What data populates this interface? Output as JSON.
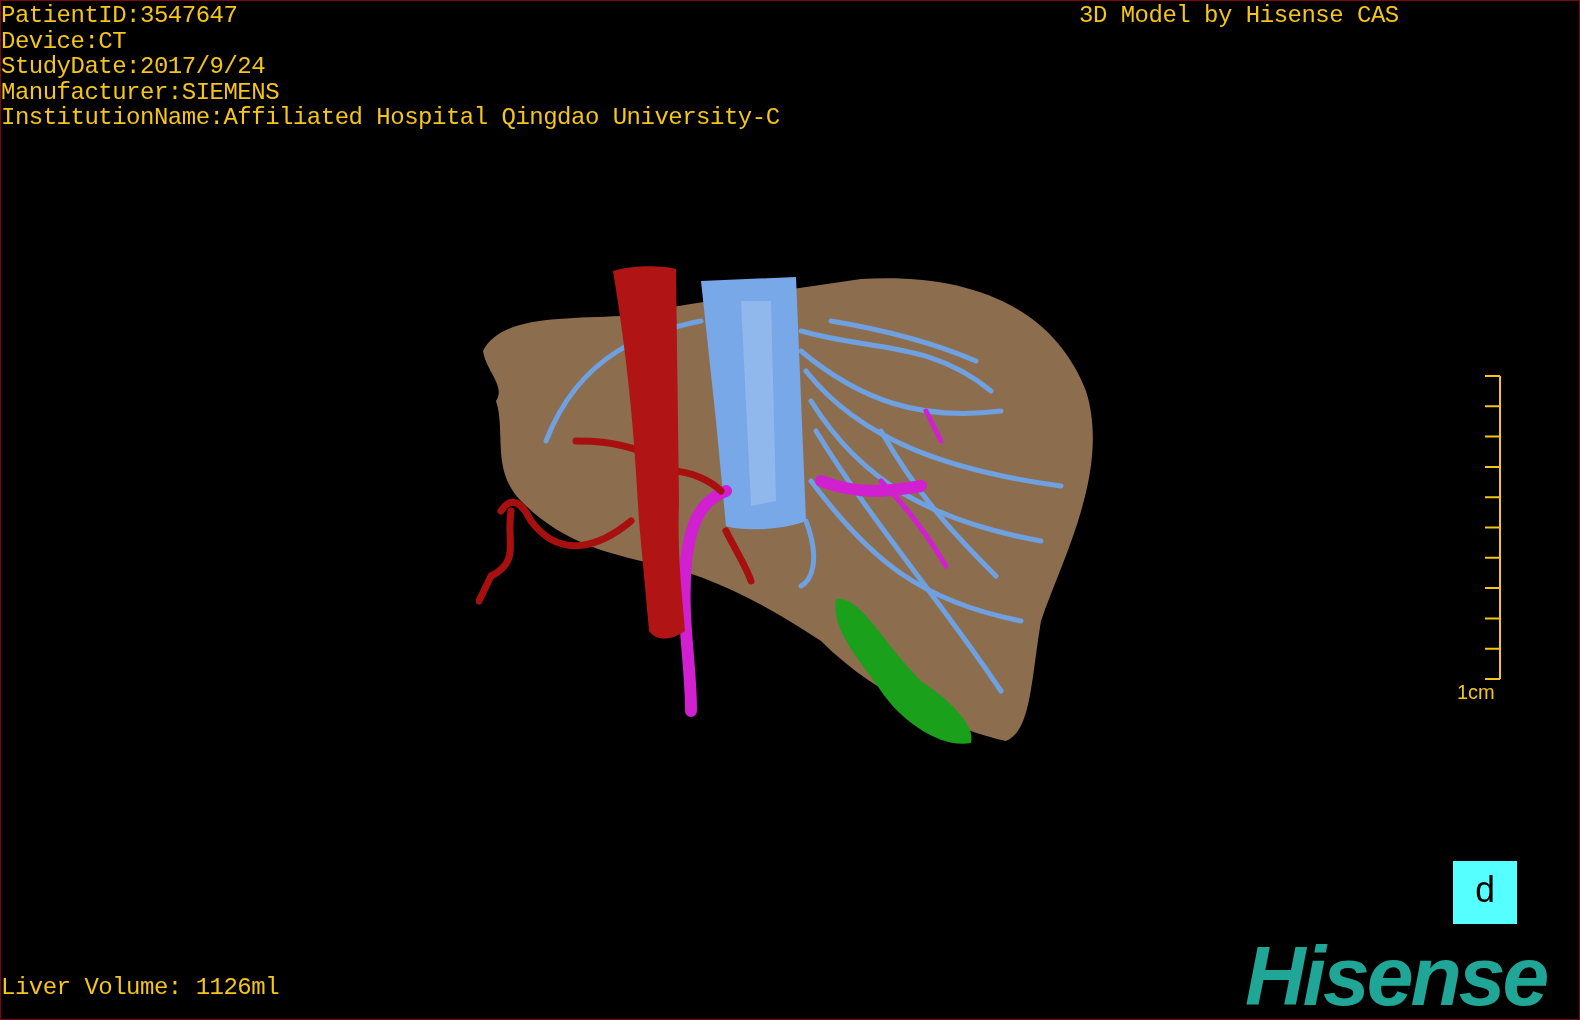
{
  "overlay": {
    "top_left": [
      "PatientID:3547647",
      "Device:CT",
      "StudyDate:2017/9/24",
      "Manufacturer:SIEMENS",
      "InstitutionName:Affiliated Hospital Qingdao University-C"
    ],
    "top_right": "3D Model by Hisense CAS",
    "bottom_left": "Liver Volume: 1126ml"
  },
  "scale_bar": {
    "label": "1cm"
  },
  "orientation_button": {
    "label": "d"
  },
  "logo": {
    "text": "Hisense"
  }
}
